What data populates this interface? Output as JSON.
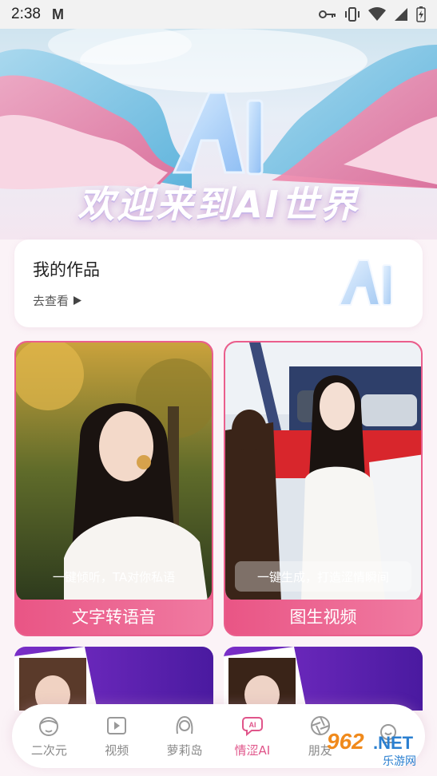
{
  "status_bar": {
    "time": "2:38",
    "mail_glyph": "M"
  },
  "hero": {
    "title": "欢迎来到AI世界"
  },
  "works": {
    "title": "我的作品",
    "link": "去查看"
  },
  "features": [
    {
      "caption": "一键倾听，TA对你私语",
      "label": "文字转语音"
    },
    {
      "caption": "一键生成，打造涩情瞬间",
      "label": "图生视频"
    }
  ],
  "bottom_nav": {
    "active_index": 3,
    "items": [
      {
        "label": "二次元",
        "icon": "anime-icon"
      },
      {
        "label": "视频",
        "icon": "play-icon"
      },
      {
        "label": "萝莉岛",
        "icon": "girl-icon"
      },
      {
        "label": "情涩AI",
        "icon": "ai-chat-icon"
      },
      {
        "label": "朋友",
        "icon": "aperture-icon"
      },
      {
        "label": "",
        "icon": "smile-icon"
      }
    ]
  },
  "watermark": {
    "text": "962.NET",
    "subtext": "乐游网"
  },
  "colors": {
    "accent": "#e95585",
    "active_nav": "#e0558a",
    "card_border": "#ea5e8c"
  }
}
